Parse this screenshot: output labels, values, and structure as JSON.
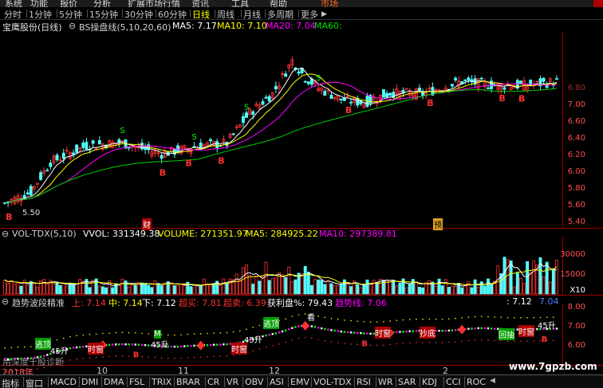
{
  "menu": [
    {
      "label": "系统"
    },
    {
      "label": "功能"
    },
    {
      "label": "报价"
    },
    {
      "label": "分析"
    },
    {
      "label": "扩展市场行情"
    },
    {
      "label": "资讯"
    },
    {
      "label": "工具"
    },
    {
      "label": "帮助"
    },
    {
      "label": "市场"
    }
  ],
  "periods": [
    {
      "label": "分时"
    },
    {
      "label": "1分钟"
    },
    {
      "label": "5分钟"
    },
    {
      "label": "15分钟"
    },
    {
      "label": "30分钟"
    },
    {
      "label": "60分钟"
    },
    {
      "label": "日线"
    },
    {
      "label": "周线"
    },
    {
      "label": "月线"
    },
    {
      "label": "多周期"
    },
    {
      "label": "更多"
    }
  ],
  "main_panel": {
    "stock": "宝鹰股份(日线)",
    "indicator": "BS操盘线(5,10,20,60)",
    "ma5": "MA5: 7.17",
    "ma10": "MA10: 7.10",
    "ma20": "MA20: 7.04",
    "ma60": "MA60:",
    "low_price_label": "5.50",
    "marker_cai": "财",
    "marker_yu": "预"
  },
  "vol_panel": {
    "name": "VOL-TDX(5,10)",
    "vvol": "VVOL: 331349.38",
    "volume": "VOLUME: 271351.97",
    "ma5": "MA5: 284925.22",
    "ma10": "MA10: 297389.81",
    "unit": "X10"
  },
  "trend_panel": {
    "name": "趋势波段精准",
    "up": "上: 7.14",
    "mid": "中: 7.14",
    "down": "下: 7.12",
    "overbuy": "超买: 7.81",
    "oversell": "超卖: 6.39",
    "profit": "获利盘%: 79.43",
    "trend": "趋势线: 7.06",
    "right_val1": ": 7.12",
    "right_val2": "7.04",
    "annot_escape": "逃顶",
    "annot_bottom": "抄底",
    "annot_time": "时窗",
    "annot_rise": "45升",
    "annot_pullback": "回抽",
    "annot_retreat": "逃顶",
    "annot_watch": "看",
    "annot_buy_m": "M"
  },
  "watermark": "用深度千股诊断",
  "site": "www.7gpzb.com",
  "bottom_tabs": [
    {
      "label": "指标"
    },
    {
      "label": "窗口"
    },
    {
      "label": "MACD"
    },
    {
      "label": "DMI"
    },
    {
      "label": "DMA"
    },
    {
      "label": "FSL"
    },
    {
      "label": "TRIX"
    },
    {
      "label": "BRAR"
    },
    {
      "label": "CR"
    },
    {
      "label": "VR"
    },
    {
      "label": "OBV"
    },
    {
      "label": "ASI"
    },
    {
      "label": "EMV"
    },
    {
      "label": "VOL-TDX"
    },
    {
      "label": "RSI"
    },
    {
      "label": "WR"
    },
    {
      "label": "SAR"
    },
    {
      "label": "KDJ"
    },
    {
      "label": "CCI"
    },
    {
      "label": "ROC"
    }
  ],
  "x_labels": [
    {
      "label": "2018年"
    },
    {
      "label": "10"
    },
    {
      "label": "11"
    },
    {
      "label": "12"
    },
    {
      "label": "2"
    }
  ],
  "chart_data": {
    "type": "candlestick",
    "price_axis": {
      "ticks": [
        "7.00",
        "6.80",
        "6.60",
        "6.40",
        "6.20",
        "6.00",
        "5.80",
        "5.60",
        "5.40"
      ],
      "range": [
        5.3,
        7.6
      ]
    },
    "volume_axis": {
      "ticks": [
        "30000",
        "15000"
      ]
    },
    "trend_axis": {
      "ticks": [
        "8.00",
        "7.00",
        "6.00"
      ],
      "range": [
        5.7,
        8.4
      ]
    },
    "signals": {
      "buy_label": "B",
      "sell_label": "S"
    }
  }
}
